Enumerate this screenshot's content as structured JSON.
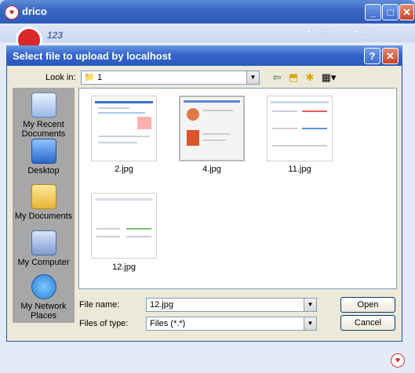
{
  "app": {
    "title": "drico",
    "nav": {
      "help": "• Help",
      "about": "• About"
    },
    "brand": "123"
  },
  "dialog": {
    "title": "Select file to upload by localhost",
    "help_btn": "?",
    "close_btn": "✕",
    "look_in_label": "Look in:",
    "look_in_value": "1"
  },
  "places": [
    {
      "label": "My Recent Documents",
      "icon": "recent-documents-icon"
    },
    {
      "label": "Desktop",
      "icon": "desktop-icon"
    },
    {
      "label": "My Documents",
      "icon": "my-documents-icon"
    },
    {
      "label": "My Computer",
      "icon": "my-computer-icon"
    },
    {
      "label": "My Network Places",
      "icon": "network-places-icon"
    }
  ],
  "files": [
    {
      "name": "2.jpg"
    },
    {
      "name": "4.jpg"
    },
    {
      "name": "11.jpg"
    },
    {
      "name": "12.jpg"
    }
  ],
  "form": {
    "file_name_label": "File name:",
    "file_name_value": "12.jpg",
    "file_type_label": "Files of type:",
    "file_type_value": "Files (*.*)",
    "open_label": "Open",
    "cancel_label": "Cancel"
  },
  "colors": {
    "titlebar": "#3466cc",
    "dialog_bg": "#ece9d8",
    "accent_red": "#d8282a"
  }
}
